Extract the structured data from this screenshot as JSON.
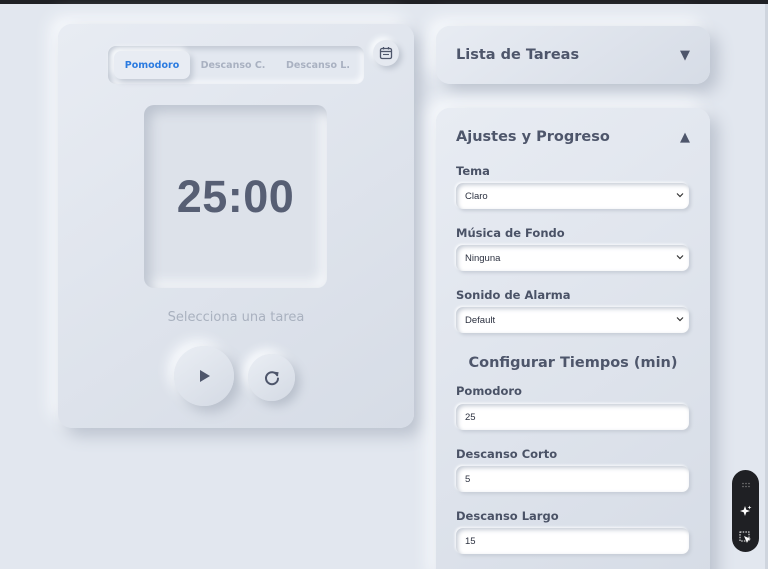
{
  "timer": {
    "tabs": [
      {
        "label": "Pomodoro",
        "active": true
      },
      {
        "label": "Descanso C.",
        "active": false
      },
      {
        "label": "Descanso L.",
        "active": false
      }
    ],
    "time_display": "25:00",
    "task_prompt": "Selecciona una tarea",
    "icons": {
      "calendar": "calendar-icon",
      "play": "play-icon",
      "reset": "refresh-icon"
    }
  },
  "tasks_panel": {
    "title": "Lista de Tareas",
    "toggle": "▼"
  },
  "settings_panel": {
    "title": "Ajustes y Progreso",
    "toggle": "▲",
    "theme": {
      "label": "Tema",
      "value": "Claro"
    },
    "music": {
      "label": "Música de Fondo",
      "value": "Ninguna"
    },
    "alarm": {
      "label": "Sonido de Alarma",
      "value": "Default"
    },
    "times_heading": "Configurar Tiempos (min)",
    "pomodoro": {
      "label": "Pomodoro",
      "value": "25"
    },
    "short_break": {
      "label": "Descanso Corto",
      "value": "5"
    },
    "long_break": {
      "label": "Descanso Largo",
      "value": "15"
    }
  },
  "colors": {
    "background": "#e2e7ef",
    "accent": "#2b7be0",
    "text": "#4e566b",
    "muted": "#a9b1bf"
  }
}
